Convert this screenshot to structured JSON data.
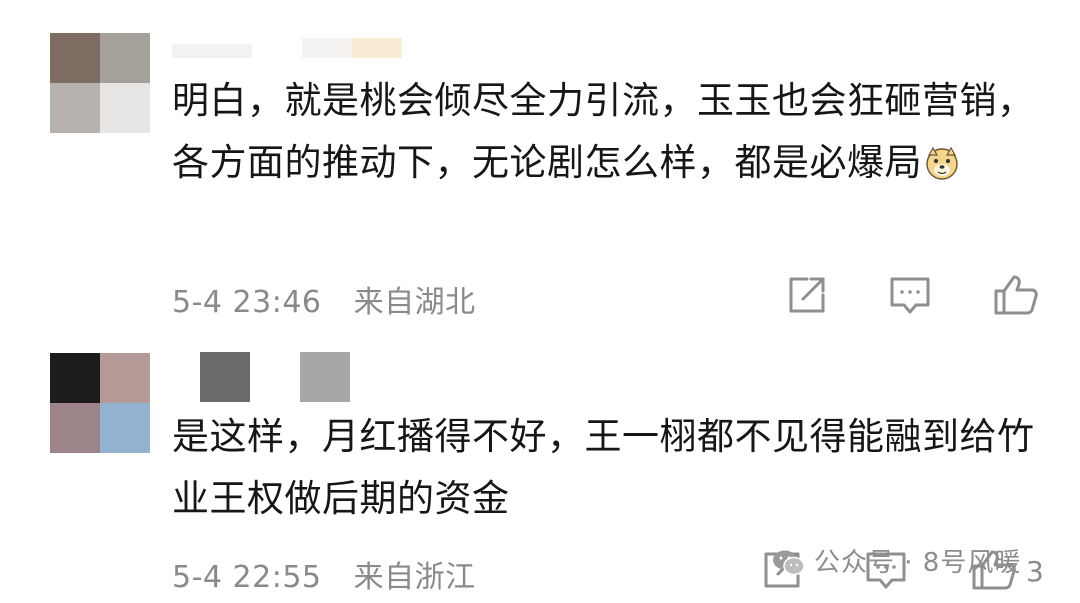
{
  "comments": [
    {
      "text": "明白，就是桃会倾尽全力引流，玉玉也会狂砸营销，各方面的推动下，无论剧怎么样，都是必爆局",
      "emoji": "doge-emoji",
      "timestamp": "5-4 23:46",
      "location": "来自湖北",
      "actions": [
        "share-icon",
        "comment-icon",
        "like-icon"
      ]
    },
    {
      "text": "是这样，月红播得不好，王一栩都不见得能融到给竹业王权做后期的资金",
      "timestamp": "5-4 22:55",
      "location": "来自浙江",
      "like_count": "3",
      "actions": [
        "share-icon",
        "comment-icon",
        "like-icon"
      ]
    }
  ],
  "watermark": {
    "text": "公众号 · 8号风暖"
  },
  "colors": {
    "text": "#161616",
    "meta": "#8a8a8a",
    "icon": "#8f8f8f",
    "background": "#ffffff"
  }
}
